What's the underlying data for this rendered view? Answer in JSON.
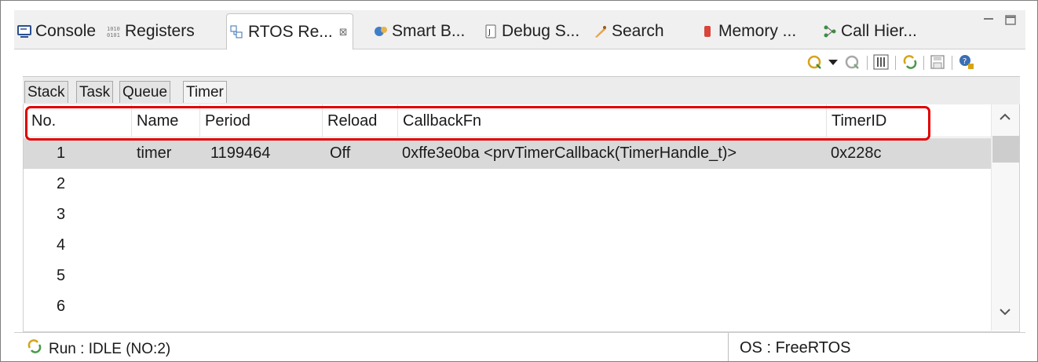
{
  "tabs": [
    {
      "label": "Console",
      "icon": "console-icon",
      "active": false
    },
    {
      "label": "Registers",
      "icon": "registers-icon",
      "active": false
    },
    {
      "label": "RTOS Re...",
      "icon": "rtos-icon",
      "active": true
    },
    {
      "label": "Smart B...",
      "icon": "smart-browser-icon",
      "active": false
    },
    {
      "label": "Debug S...",
      "icon": "debug-icon",
      "active": false
    },
    {
      "label": "Search",
      "icon": "search-icon",
      "active": false
    },
    {
      "label": "Memory ...",
      "icon": "memory-icon",
      "active": false
    },
    {
      "label": "Call Hier...",
      "icon": "call-hierarchy-icon",
      "active": false
    }
  ],
  "close_glyph": "⊠",
  "subtabs": [
    "Stack",
    "Task",
    "Queue",
    "Timer"
  ],
  "selected_subtab": "Timer",
  "table": {
    "columns": [
      "No.",
      "Name",
      "Period",
      "Reload",
      "CallbackFn",
      "TimerID"
    ],
    "rows": [
      {
        "no": "1",
        "name": "timer",
        "period": "1199464",
        "reload": "Off",
        "callback": "0xffe3e0ba <prvTimerCallback(TimerHandle_t)>",
        "timerid": "0x228c"
      },
      {
        "no": "2",
        "name": "",
        "period": "",
        "reload": "",
        "callback": "",
        "timerid": ""
      },
      {
        "no": "3",
        "name": "",
        "period": "",
        "reload": "",
        "callback": "",
        "timerid": ""
      },
      {
        "no": "4",
        "name": "",
        "period": "",
        "reload": "",
        "callback": "",
        "timerid": ""
      },
      {
        "no": "5",
        "name": "",
        "period": "",
        "reload": "",
        "callback": "",
        "timerid": ""
      },
      {
        "no": "6",
        "name": "",
        "period": "",
        "reload": "",
        "callback": "",
        "timerid": ""
      }
    ]
  },
  "status": {
    "left": "Run : IDLE (NO:2)",
    "right": "OS : FreeRTOS"
  },
  "colors": {
    "highlight": "#e00000",
    "selected_row": "#d9d9d9"
  }
}
